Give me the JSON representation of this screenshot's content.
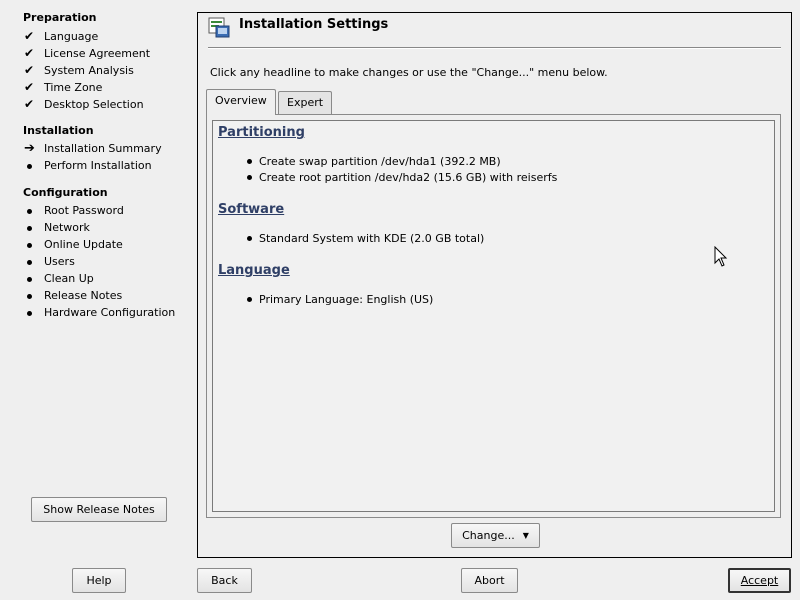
{
  "sidebar": {
    "sections": [
      {
        "title": "Preparation",
        "items": [
          {
            "label": "Language",
            "status": "done"
          },
          {
            "label": "License Agreement",
            "status": "done"
          },
          {
            "label": "System Analysis",
            "status": "done"
          },
          {
            "label": "Time Zone",
            "status": "done"
          },
          {
            "label": "Desktop Selection",
            "status": "done"
          }
        ]
      },
      {
        "title": "Installation",
        "items": [
          {
            "label": "Installation Summary",
            "status": "current"
          },
          {
            "label": "Perform Installation",
            "status": "pending"
          }
        ]
      },
      {
        "title": "Configuration",
        "items": [
          {
            "label": "Root Password",
            "status": "pending"
          },
          {
            "label": "Network",
            "status": "pending"
          },
          {
            "label": "Online Update",
            "status": "pending"
          },
          {
            "label": "Users",
            "status": "pending"
          },
          {
            "label": "Clean Up",
            "status": "pending"
          },
          {
            "label": "Release Notes",
            "status": "pending"
          },
          {
            "label": "Hardware Configuration",
            "status": "pending"
          }
        ]
      }
    ],
    "release_notes_button": "Show Release Notes"
  },
  "main": {
    "title": "Installation Settings",
    "instructions": "Click any headline to make changes or use the \"Change...\" menu below.",
    "tabs": [
      {
        "label": "Overview",
        "active": true
      },
      {
        "label": "Expert",
        "active": false
      }
    ],
    "sections": [
      {
        "heading": "Partitioning",
        "items": [
          "Create swap partition /dev/hda1 (392.2 MB)",
          "Create root partition /dev/hda2 (15.6 GB) with reiserfs"
        ]
      },
      {
        "heading": "Software",
        "items": [
          "Standard System with KDE (2.0 GB total)"
        ]
      },
      {
        "heading": "Language",
        "items": [
          "Primary Language: English (US)"
        ]
      }
    ],
    "change_button": "Change..."
  },
  "footer": {
    "help": "Help",
    "back": "Back",
    "abort": "Abort",
    "accept": "Accept"
  },
  "icons": {
    "done": "checkmark-icon",
    "current": "arrow-right-icon",
    "pending": "bullet-icon"
  },
  "colors": {
    "background": "#efefef",
    "heading_link": "#2f3f66"
  }
}
